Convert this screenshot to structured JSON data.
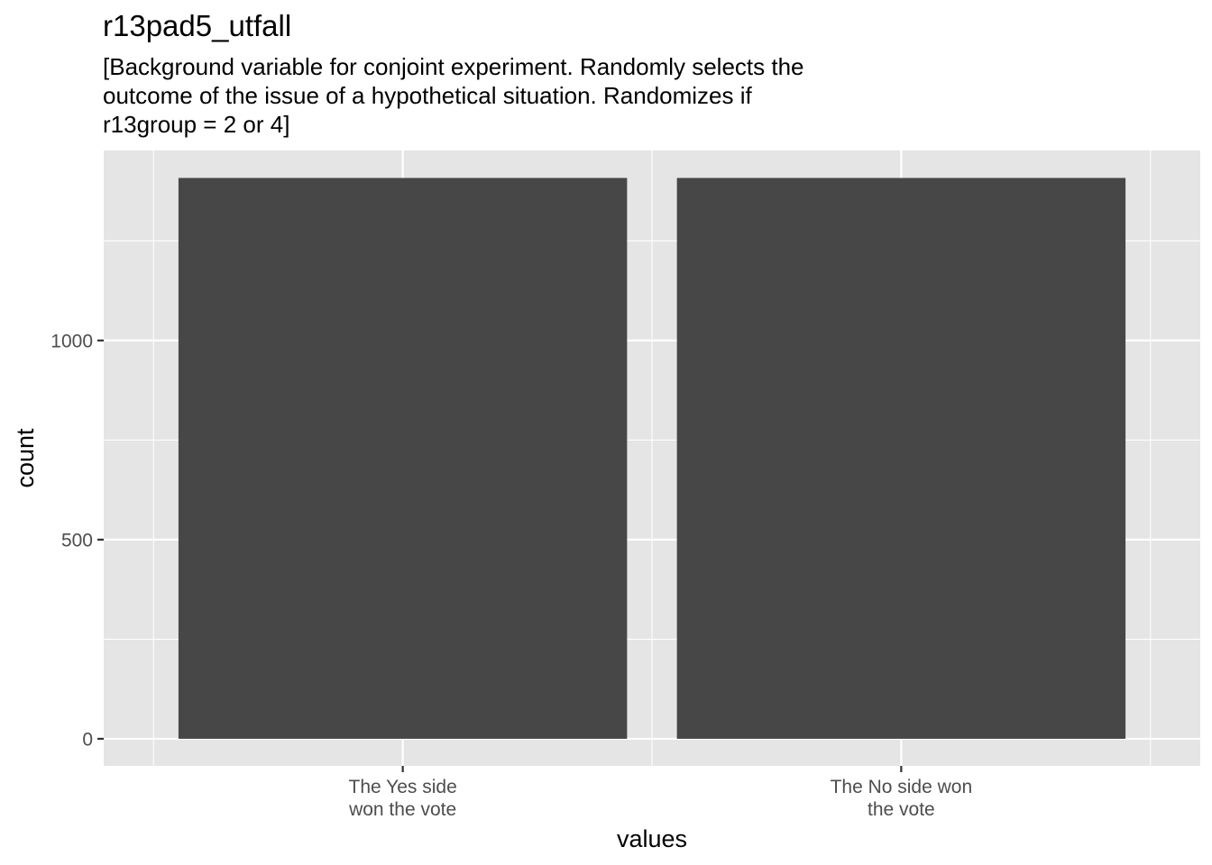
{
  "chart_data": {
    "type": "bar",
    "title": "r13pad5_utfall",
    "subtitle_lines": [
      "[Background variable for conjoint experiment. Randomly selects the",
      "outcome of the issue of a hypothetical situation. Randomizes if",
      "r13group = 2 or 4]"
    ],
    "categories": [
      [
        "The Yes side",
        "won the vote"
      ],
      [
        "The No side won",
        "the vote"
      ]
    ],
    "values": [
      1408,
      1408
    ],
    "xlabel": "values",
    "ylabel": "count",
    "ylim": [
      -68,
      1477
    ],
    "yticks": [
      0,
      500,
      1000
    ],
    "grid": true,
    "legend": "none",
    "colors": {
      "bar": "#474747",
      "panel": "#e5e5e5",
      "grid": "#ffffff",
      "tick_text": "#4d4d4d",
      "tick_mark": "#333333"
    }
  }
}
